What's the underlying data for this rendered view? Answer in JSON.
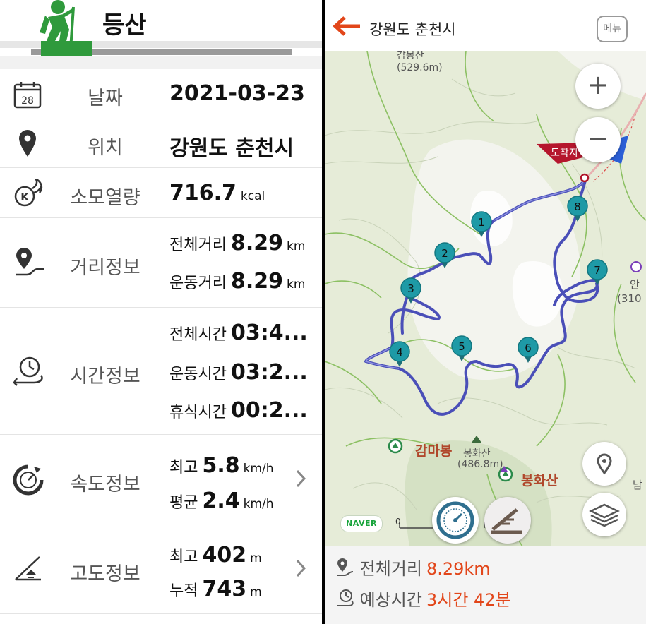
{
  "left": {
    "title": "등산",
    "date": {
      "label": "날짜",
      "value": "2021-03-23",
      "icon_day": "28"
    },
    "location": {
      "label": "위치",
      "value": "강원도 춘천시"
    },
    "calories": {
      "label": "소모열량",
      "value": "716.7",
      "unit": "kcal"
    },
    "distance": {
      "label": "거리정보",
      "total_label": "전체거리",
      "total_value": "8.29",
      "total_unit": "km",
      "move_label": "운동거리",
      "move_value": "8.29",
      "move_unit": "km"
    },
    "time": {
      "label": "시간정보",
      "total_label": "전체시간",
      "total_value": "03:4...",
      "move_label": "운동시간",
      "move_value": "03:2...",
      "rest_label": "휴식시간",
      "rest_value": "00:2..."
    },
    "speed": {
      "label": "속도정보",
      "max_label": "최고",
      "max_value": "5.8",
      "max_unit": "km/h",
      "avg_label": "평균",
      "avg_value": "2.4",
      "avg_unit": "km/h"
    },
    "altitude": {
      "label": "고도정보",
      "max_label": "최고",
      "max_value": "402",
      "max_unit": "m",
      "cum_label": "누적",
      "cum_value": "743",
      "cum_unit": "m"
    }
  },
  "right": {
    "header": {
      "location": "강원도 춘천시",
      "menu_label": "메뉴"
    },
    "map": {
      "labels": {
        "top_peak_name": "감봉산",
        "top_peak_height": "(529.6m)",
        "gamabong": "감마봉",
        "bonghwasan_small": "봉화산",
        "bonghwasan_height": "(486.8m)",
        "bonghwasan": "봉화산",
        "right_edge_1": "안",
        "right_edge_2": "(310",
        "right_edge_3": "남",
        "arrival_flag": "도착지"
      },
      "waypoints": [
        "1",
        "2",
        "3",
        "4",
        "5",
        "6",
        "7",
        "8"
      ],
      "naver_logo": "NAVER",
      "zoom_in": "+",
      "zoom_out": "−",
      "scale_zero": "0"
    },
    "footer": {
      "total_distance_label": "전체거리",
      "total_distance_value": "8.29km",
      "expected_time_label": "예상시간",
      "expected_time_value": "3시간 42분"
    }
  },
  "colors": {
    "accent": "#e2461a",
    "route": "#4a4fb8",
    "waypoint": "#1e9aa6",
    "hiker": "#2f9a3c"
  }
}
